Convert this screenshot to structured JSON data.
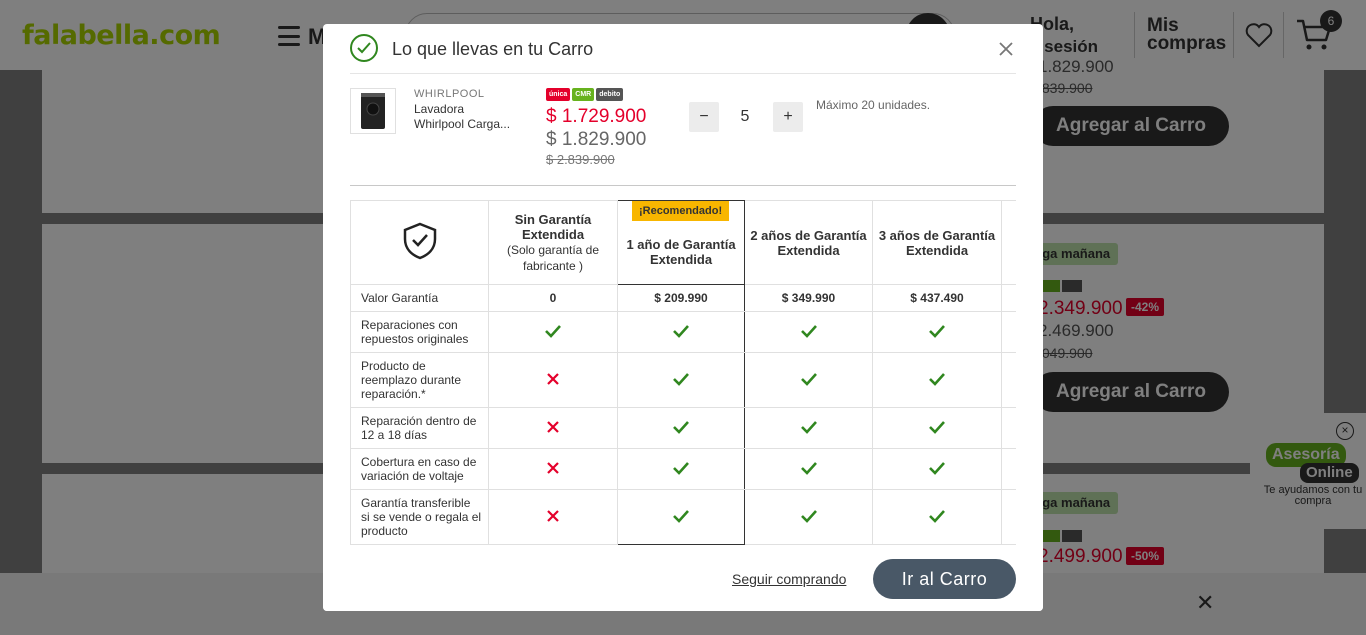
{
  "background": {
    "logo": "falabella.com",
    "menu_letter": "M",
    "greeting": "Hola,",
    "login": "a sesión",
    "my_purchases_line1": "Mis",
    "my_purchases_line2": "compras",
    "cart_count": "6",
    "card1": {
      "price_old": "1.829.900",
      "price_strike": ".839.900",
      "add_button": "Agregar al Carro"
    },
    "card2": {
      "badge": "ega mañana",
      "price_red": "2.349.900",
      "discount": "-42%",
      "price_old": "2.469.900",
      "price_strike": ".049.900",
      "add_button": "Agregar al Carro"
    },
    "card3": {
      "badge": "ega mañana",
      "price_red": "2.499.900",
      "discount": "-50%"
    },
    "chat": {
      "bubble1": "Asesoría",
      "bubble2": "Online",
      "subtitle": "Te ayudamos con tu compra"
    }
  },
  "modal": {
    "title": "Lo que llevas en tu Carro",
    "product": {
      "brand": "WHIRLPOOL",
      "name_line1": "Lavadora",
      "name_line2": "Whirlpool Carga...",
      "logos": [
        "única",
        "CMR",
        "debito"
      ],
      "price_red": "$ 1.729.900",
      "price_gray": "$ 1.829.900",
      "price_strike": "$ 2.839.900",
      "quantity": "5",
      "minus": "−",
      "plus": "+",
      "max_note": "Máximo 20 unidades."
    },
    "warranty": {
      "recommended_badge": "¡Recomendado!",
      "columns": [
        {
          "title": "Sin Garantía Extendida",
          "subtitle": "(Solo garantía de fabricante )"
        },
        {
          "title": "1 año de Garantía Extendida",
          "subtitle": ""
        },
        {
          "title": "2 años de Garantía Extendida",
          "subtitle": ""
        },
        {
          "title": "3 años de Garantía Extendida",
          "subtitle": ""
        }
      ],
      "value_row": {
        "label": "Valor Garantía",
        "values": [
          "0",
          "$ 209.990",
          "$ 349.990",
          "$ 437.490"
        ]
      },
      "feature_rows": [
        {
          "label": "Reparaciones con repuestos originales",
          "values": [
            true,
            true,
            true,
            true
          ]
        },
        {
          "label": "Producto de reemplazo durante reparación.*",
          "values": [
            false,
            true,
            true,
            true
          ]
        },
        {
          "label": "Reparación dentro de 12 a 18 días",
          "values": [
            false,
            true,
            true,
            true
          ]
        },
        {
          "label": "Cobertura en caso de variación de voltaje",
          "values": [
            false,
            true,
            true,
            true
          ]
        },
        {
          "label": "Garantía transferible si se vende o regala el producto",
          "values": [
            false,
            true,
            true,
            true
          ]
        }
      ]
    },
    "footer": {
      "continue_link": "Seguir comprando",
      "go_to_cart": "Ir al Carro"
    },
    "colors": {
      "check_green": "#30871f",
      "cross_red": "#e4002b",
      "price_red": "#e4002b",
      "badge_yellow": "#f8b600",
      "cart_button": "#495867"
    }
  }
}
